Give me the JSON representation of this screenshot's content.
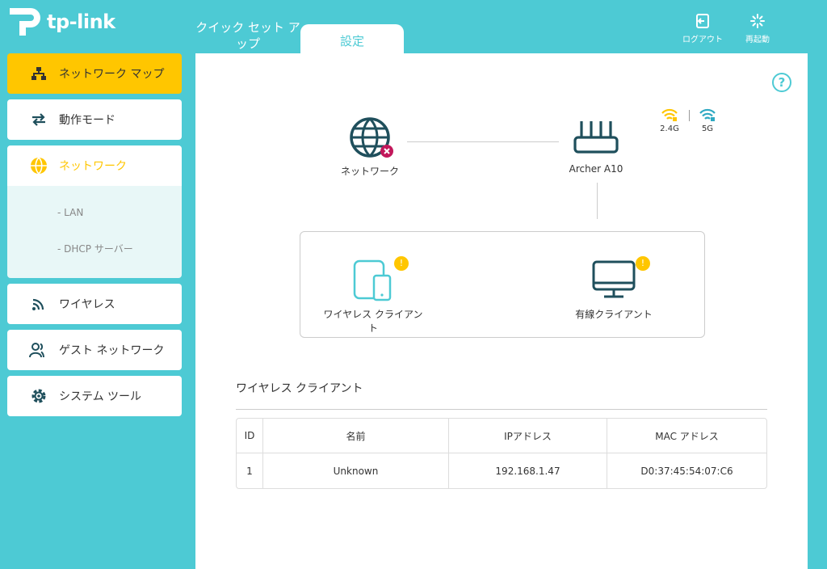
{
  "brand": {
    "logo_text": "tp-link"
  },
  "top_tabs": {
    "quick_setup": "クイック セット アップ",
    "settings": "設定"
  },
  "top_actions": {
    "logout": "ログアウト",
    "reboot": "再起動"
  },
  "sidebar": {
    "items": [
      {
        "label": "ネットワーク マップ",
        "icon": "network-map-icon",
        "active": true
      },
      {
        "label": "動作モード",
        "icon": "operation-mode-icon"
      },
      {
        "label": "ネットワーク",
        "icon": "globe-icon",
        "expanded": true,
        "sub_items": [
          {
            "label": "- LAN"
          },
          {
            "label": "- DHCP サーバー"
          }
        ]
      },
      {
        "label": "ワイヤレス",
        "icon": "wireless-icon"
      },
      {
        "label": "ゲスト ネットワーク",
        "icon": "guest-network-icon"
      },
      {
        "label": "システム ツール",
        "icon": "gear-icon"
      }
    ]
  },
  "map": {
    "internet_label": "ネットワーク",
    "router_label": "Archer A10",
    "bands": [
      "2.4G",
      "5G"
    ],
    "wireless_clients_label": "ワイヤレス クライアント",
    "wired_clients_label": "有線クライアント",
    "badge": "!"
  },
  "client_section": {
    "title": "ワイヤレス クライアント",
    "columns": [
      "ID",
      "名前",
      "IPアドレス",
      "MAC アドレス"
    ],
    "rows": [
      [
        "1",
        "Unknown",
        "192.168.1.47",
        "D0:37:45:54:07:C6"
      ]
    ]
  },
  "colors": {
    "accent": "#4dcad4",
    "active": "#ffc600",
    "icon_dark": "#1f4f5c",
    "error": "#c2185b"
  }
}
